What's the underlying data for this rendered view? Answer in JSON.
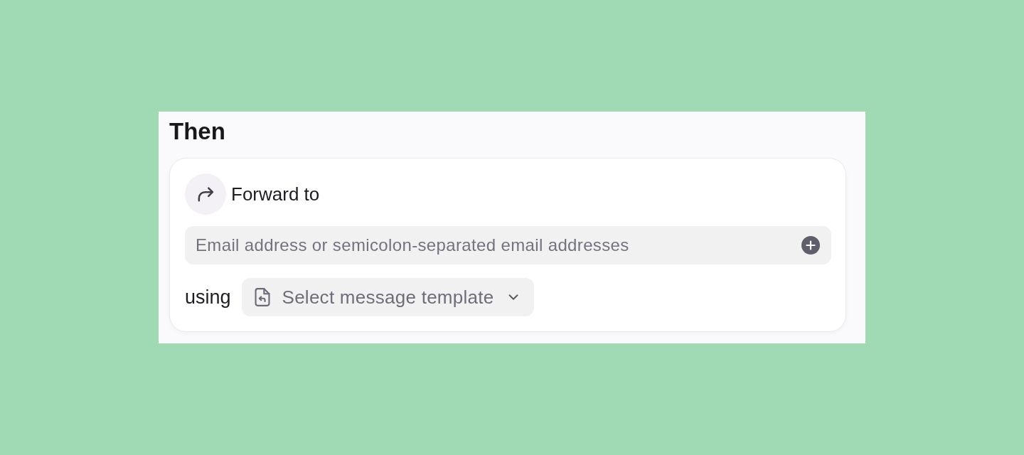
{
  "panel": {
    "title": "Then"
  },
  "action": {
    "label": "Forward to"
  },
  "recipients_field": {
    "placeholder": "Email address or semicolon-separated email addresses"
  },
  "template_row": {
    "label": "using",
    "select": {
      "placeholder": "Select message template"
    }
  }
}
